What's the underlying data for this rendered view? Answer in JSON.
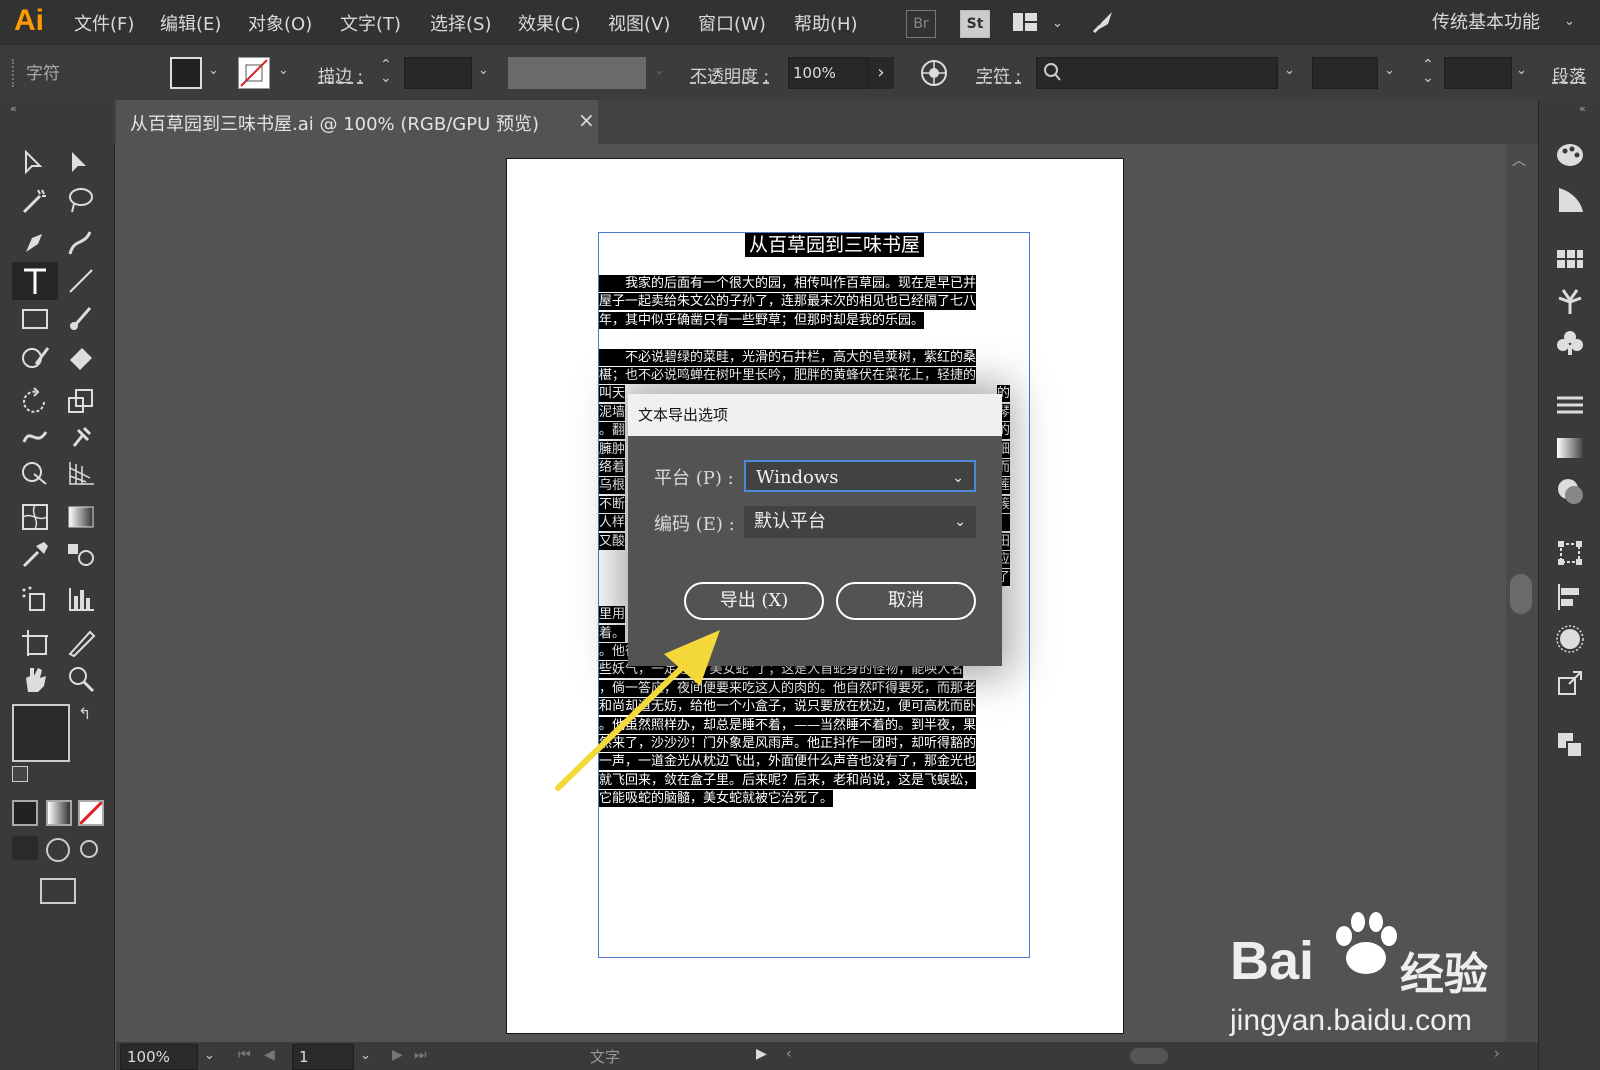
{
  "app": {
    "logo": "Ai",
    "menus": [
      "文件(F)",
      "编辑(E)",
      "对象(O)",
      "文字(T)",
      "选择(S)",
      "效果(C)",
      "视图(V)",
      "窗口(W)",
      "帮助(H)"
    ],
    "bridge_label": "Br",
    "stock_label": "St",
    "workspace": "传统基本功能"
  },
  "control_bar": {
    "context_label": "字符",
    "stroke_label": "描边 :",
    "opacity_label": "不透明度 :",
    "opacity_value": "100%",
    "character_label": "字符 :",
    "paragraph_label": "段落"
  },
  "document_tab": {
    "title": "从百草园到三味书屋.ai @ 100% (RGB/GPU 预览)",
    "close": "×"
  },
  "document": {
    "title": "从百草园到三味书屋",
    "lines": [
      "　　我家的后面有一个很大的园，相传叫作百草园。现在是早已并",
      "屋子一起卖给朱文公的子孙了，连那最末次的相见也已经隔了七八",
      "年，其中似乎确凿只有一些野草；但那时却是我的乐园。",
      "",
      "　　不必说碧绿的菜畦，光滑的石井栏，高大的皂荚树，紫红的桑",
      "椹；也不必说鸣蝉在树叶里长吟，肥胖的黄蜂伏在菜花上，轻捷的",
      "叫天",
      "泥墙",
      "。翻",
      "臃肿",
      "络着",
      "乌根",
      "不断",
      "人样",
      "又酸",
      "",
      "",
      "",
      "里用",
      "着。",
      "。他很高兴，但竟给那走来夜谈的老和尚识破了机关。说他脸上有",
      "些妖气，一定遇见“美女蛇”了；这是人首蛇身的怪物，能唤人名",
      "，倘一答应，夜间便要来吃这人的肉的。他自然吓得要死，而那老",
      "和尚却道无妨，给他一个小盒子，说只要放在枕边，便可高枕而卧",
      "。他虽然照样办，却总是睡不着，——当然睡不着的。到半夜，果",
      "然来了，沙沙沙！门外象是风雨声。他正抖作一团时，却听得豁的",
      "一声，一道金光从枕边飞出，外面便什么声音也没有了，那金光也",
      "就飞回来，敛在盒子里。后来呢？后来，老和尚说，这是飞蜈蚣，",
      "它能吸蛇的脑髓，美女蛇就被它治死了。"
    ],
    "right_fragments": [
      "的",
      "琴",
      "的",
      "细",
      "而",
      "莲",
      "簇",
      "，",
      "田",
      "应",
      "了"
    ]
  },
  "dialog": {
    "title": "文本导出选项",
    "platform_label": "平台 (P) :",
    "platform_value": "Windows",
    "encoding_label": "编码 (E) :",
    "encoding_value": "默认平台",
    "export_button": "导出 (X)",
    "cancel_button": "取消"
  },
  "status_bar": {
    "zoom": "100%",
    "artboard": "1",
    "tool_name": "文字"
  },
  "watermark": {
    "brand": "Bai",
    "brand2": "经验",
    "url": "jingyan.baidu.com"
  },
  "colors": {
    "accent_arrow": "#f5d93a",
    "logo_orange": "#ff9a00",
    "selection_blue": "#4a7bd0"
  }
}
